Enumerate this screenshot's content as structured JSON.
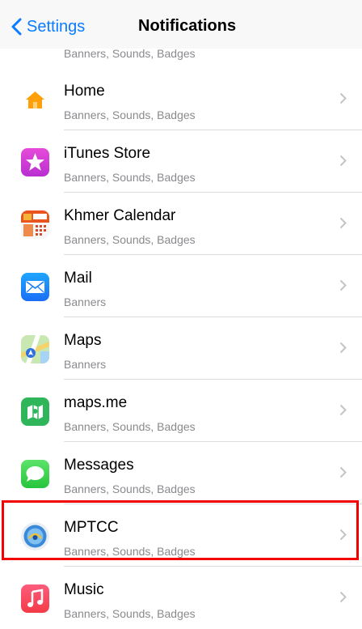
{
  "nav": {
    "back_label": "Settings",
    "title": "Notifications"
  },
  "partial_row": {
    "subtitle": "Banners, Sounds, Badges"
  },
  "apps": [
    {
      "name": "Home",
      "subtitle": "Banners, Sounds, Badges",
      "icon": "home-icon"
    },
    {
      "name": "iTunes Store",
      "subtitle": "Banners, Sounds, Badges",
      "icon": "itunes-store-icon"
    },
    {
      "name": "Khmer Calendar",
      "subtitle": "Banners, Sounds, Badges",
      "icon": "khmer-calendar-icon"
    },
    {
      "name": "Mail",
      "subtitle": "Banners",
      "icon": "mail-icon"
    },
    {
      "name": "Maps",
      "subtitle": "Banners",
      "icon": "maps-icon"
    },
    {
      "name": "maps.me",
      "subtitle": "Banners, Sounds, Badges",
      "icon": "maps-me-icon"
    },
    {
      "name": "Messages",
      "subtitle": "Banners, Sounds, Badges",
      "icon": "messages-icon"
    },
    {
      "name": "MPTCC",
      "subtitle": "Banners, Sounds, Badges",
      "icon": "mptcc-icon",
      "highlighted": true
    },
    {
      "name": "Music",
      "subtitle": "Banners, Sounds, Badges",
      "icon": "music-icon"
    }
  ],
  "colors": {
    "accent": "#0a7cff",
    "highlight": "#f20000",
    "separator": "#dcdcdf"
  }
}
